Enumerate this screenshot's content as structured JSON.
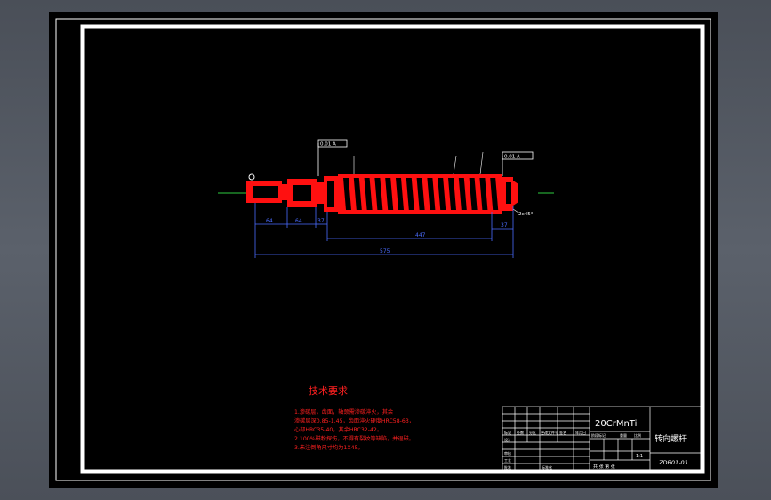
{
  "drawing": {
    "part_name": "转向螺杆",
    "material": "20CrMnTi",
    "drawing_number": "ZDB01-01",
    "scale": "1:1",
    "sheet_info": "共  张  第  张"
  },
  "tech_requirements": {
    "heading": "技术要求",
    "lines": [
      "1.渗碳层，齿面，轴颈需渗碳淬火，其余",
      "  渗碳层深0.85-1.45，齿面淬火硬度HRC58-63，",
      "  心部HRC35-40，其余HRC32-42。",
      "2.100%磁粉探伤，不得有裂纹等缺陷，并退磁。",
      "3.未注倒角尺寸均为1X45。"
    ]
  },
  "dimensions": {
    "d1": "64",
    "d2": "64",
    "d3": "37",
    "d4": "447",
    "d5": "37",
    "d6": "575",
    "chamfer": "2x45°",
    "tol_left": "0.01 A",
    "tol_right": "0.01 A"
  },
  "title_block": {
    "col_labels": [
      "标记",
      "处数",
      "分区",
      "更改文件号",
      "签名",
      "年月日"
    ],
    "row_labels": [
      "设计",
      "审核",
      "工艺",
      "标准化",
      "批准"
    ],
    "stage_labels": [
      "阶段标记",
      "重量",
      "比例"
    ]
  }
}
